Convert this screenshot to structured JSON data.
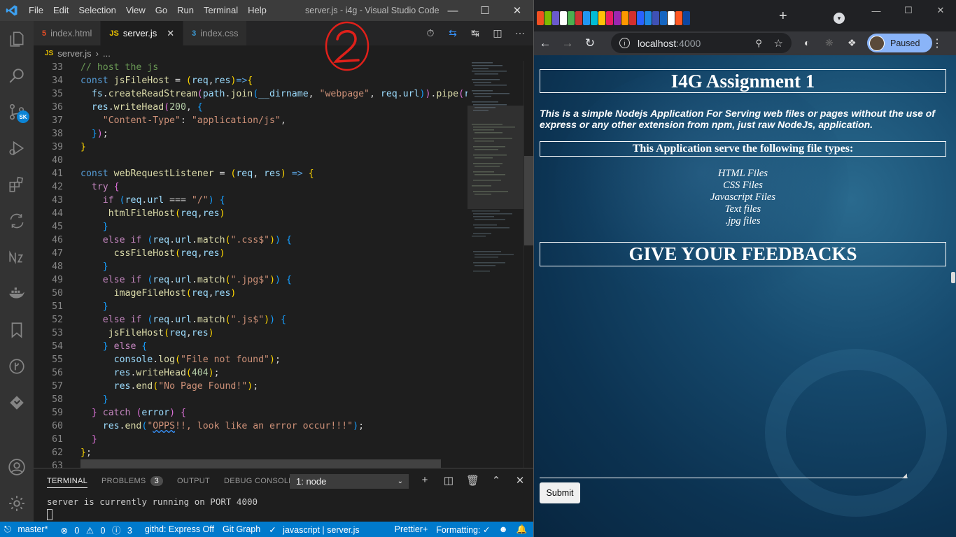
{
  "vscode": {
    "title": "server.js - i4g - Visual Studio Code",
    "menu": [
      "File",
      "Edit",
      "Selection",
      "View",
      "Go",
      "Run",
      "Terminal",
      "Help"
    ],
    "tabs": [
      {
        "label": "index.html",
        "icon": "html-file-icon",
        "active": false
      },
      {
        "label": "server.js",
        "icon": "js-file-icon",
        "active": true
      },
      {
        "label": "index.css",
        "icon": "css-file-icon",
        "active": false
      }
    ],
    "breadcrumb": {
      "file": "server.js",
      "rest": "..."
    },
    "activity_badge": "SK",
    "code_lines": [
      {
        "n": "33",
        "html": "<span class=\"c\">// host the js</span>"
      },
      {
        "n": "34",
        "html": "<span class=\"k\">const</span> <span class=\"f\">jsFileHost</span> = <span class=\"p1\">(</span><span class=\"v\">req</span>,<span class=\"v\">res</span><span class=\"p1\">)</span><span class=\"k\">=&gt;</span><span class=\"p1\">{</span>"
      },
      {
        "n": "35",
        "html": "  <span class=\"v\">fs</span>.<span class=\"f\">createReadStream</span><span class=\"p2\">(</span><span class=\"v\">path</span>.<span class=\"f\">join</span><span class=\"p3\">(</span><span class=\"v\">__dirname</span>, <span class=\"s\">\"webpage\"</span>, <span class=\"v\">req</span>.<span class=\"v\">url</span><span class=\"p3\">)</span><span class=\"p2\">)</span>.<span class=\"f\">pipe</span><span class=\"p2\">(</span><span class=\"v\">res</span>"
      },
      {
        "n": "36",
        "html": "  <span class=\"v\">res</span>.<span class=\"f\">writeHead</span><span class=\"p2\">(</span><span class=\"n\">200</span>, <span class=\"p3\">{</span>"
      },
      {
        "n": "37",
        "html": "    <span class=\"s\">\"Content-Type\"</span>: <span class=\"s\">\"application/js\"</span>,"
      },
      {
        "n": "38",
        "html": "  <span class=\"p3\">}</span><span class=\"p2\">)</span>;"
      },
      {
        "n": "39",
        "html": "<span class=\"p1\">}</span>"
      },
      {
        "n": "40",
        "html": ""
      },
      {
        "n": "41",
        "html": "<span class=\"k\">const</span> <span class=\"f\">webRequestListener</span> = <span class=\"p1\">(</span><span class=\"v\">req</span>, <span class=\"v\">res</span><span class=\"p1\">)</span> <span class=\"k\">=&gt;</span> <span class=\"p1\">{</span>"
      },
      {
        "n": "42",
        "html": "  <span class=\"kc\">try</span> <span class=\"p2\">{</span>"
      },
      {
        "n": "43",
        "html": "    <span class=\"kc\">if</span> <span class=\"p3\">(</span><span class=\"v\">req</span>.<span class=\"v\">url</span> === <span class=\"s\">\"/\"</span><span class=\"p3\">)</span> <span class=\"p3\">{</span>"
      },
      {
        "n": "44",
        "html": "     <span class=\"f\">htmlFileHost</span><span class=\"p1\">(</span><span class=\"v\">req</span>,<span class=\"v\">res</span><span class=\"p1\">)</span>"
      },
      {
        "n": "45",
        "html": "    <span class=\"p3\">}</span>"
      },
      {
        "n": "46",
        "html": "    <span class=\"kc\">else</span> <span class=\"kc\">if</span> <span class=\"p3\">(</span><span class=\"v\">req</span>.<span class=\"v\">url</span>.<span class=\"f\">match</span><span class=\"p1\">(</span><span class=\"s\">\".css$\"</span><span class=\"p1\">)</span><span class=\"p3\">)</span> <span class=\"p3\">{</span>"
      },
      {
        "n": "47",
        "html": "      <span class=\"f\">cssFileHost</span><span class=\"p1\">(</span><span class=\"v\">req</span>,<span class=\"v\">res</span><span class=\"p1\">)</span>"
      },
      {
        "n": "48",
        "html": "    <span class=\"p3\">}</span>"
      },
      {
        "n": "49",
        "html": "    <span class=\"kc\">else</span> <span class=\"kc\">if</span> <span class=\"p3\">(</span><span class=\"v\">req</span>.<span class=\"v\">url</span>.<span class=\"f\">match</span><span class=\"p1\">(</span><span class=\"s\">\".jpg$\"</span><span class=\"p1\">)</span><span class=\"p3\">)</span> <span class=\"p3\">{</span>"
      },
      {
        "n": "50",
        "html": "      <span class=\"f\">imageFileHost</span><span class=\"p1\">(</span><span class=\"v\">req</span>,<span class=\"v\">res</span><span class=\"p1\">)</span>"
      },
      {
        "n": "51",
        "html": "    <span class=\"p3\">}</span>"
      },
      {
        "n": "52",
        "html": "    <span class=\"kc\">else</span> <span class=\"kc\">if</span> <span class=\"p3\">(</span><span class=\"v\">req</span>.<span class=\"v\">url</span>.<span class=\"f\">match</span><span class=\"p1\">(</span><span class=\"s\">\".js$\"</span><span class=\"p1\">)</span><span class=\"p3\">)</span> <span class=\"p3\">{</span>"
      },
      {
        "n": "53",
        "html": "     <span class=\"f\">jsFileHost</span><span class=\"p1\">(</span><span class=\"v\">req</span>,<span class=\"v\">res</span><span class=\"p1\">)</span>"
      },
      {
        "n": "54",
        "html": "    <span class=\"p3\">}</span> <span class=\"kc\">else</span> <span class=\"p3\">{</span>"
      },
      {
        "n": "55",
        "html": "      <span class=\"v\">console</span>.<span class=\"f\">log</span><span class=\"p1\">(</span><span class=\"s\">\"File not found\"</span><span class=\"p1\">)</span>;"
      },
      {
        "n": "56",
        "html": "      <span class=\"v\">res</span>.<span class=\"f\">writeHead</span><span class=\"p1\">(</span><span class=\"n\">404</span><span class=\"p1\">)</span>;"
      },
      {
        "n": "57",
        "html": "      <span class=\"v\">res</span>.<span class=\"f\">end</span><span class=\"p1\">(</span><span class=\"s\">\"No Page Found!\"</span><span class=\"p1\">)</span>;"
      },
      {
        "n": "58",
        "html": "    <span class=\"p3\">}</span>"
      },
      {
        "n": "59",
        "html": "  <span class=\"p2\">}</span> <span class=\"kc\">catch</span> <span class=\"p2\">(</span><span class=\"v\">error</span><span class=\"p2\">)</span> <span class=\"p2\">{</span>"
      },
      {
        "n": "60",
        "html": "    <span class=\"v\">res</span>.<span class=\"f\">end</span><span class=\"p3\">(</span><span class=\"s\">\"<span class=\"squig\">OPPS</span>!!, look like an error occur!!!\"</span><span class=\"p3\">)</span>;"
      },
      {
        "n": "61",
        "html": "  <span class=\"p2\">}</span>"
      },
      {
        "n": "62",
        "html": "<span class=\"p1\">}</span>;"
      },
      {
        "n": "63",
        "html": ""
      }
    ],
    "panel": {
      "tabs": [
        "TERMINAL",
        "PROBLEMS",
        "OUTPUT",
        "DEBUG CONSOLE"
      ],
      "problems_count": "3",
      "terminal_select": "1: node",
      "output": "server is currently running on PORT 4000"
    },
    "status": {
      "branch": "master*",
      "errors": "0",
      "warnings": "0",
      "info": "3",
      "githd": "githd: Express Off",
      "gitgraph": "Git Graph",
      "lang": "javascript | server.js",
      "prettier": "Prettier+",
      "formatting": "Formatting: ✓"
    }
  },
  "chrome": {
    "url_host": "localhost",
    "url_port": ":4000",
    "profile_label": "Paused",
    "page": {
      "title": "I4G Assignment 1",
      "intro": "This is a simple Nodejs Application For Serving web files or pages without the use of express or any other extension from npm, just raw NodeJs, application.",
      "subtitle": "This Application serve the following file types:",
      "file_types": [
        "HTML Files",
        "CSS Files",
        "Javascript Files",
        "Text files",
        ".jpg files"
      ],
      "feedback_heading": "GIVE YOUR FEEDBACKS",
      "submit_label": "Submit"
    }
  },
  "colors": {
    "vscode_accent": "#007acc",
    "chrome_profile": "#8ab4f8",
    "annotation": "#e0201a"
  }
}
